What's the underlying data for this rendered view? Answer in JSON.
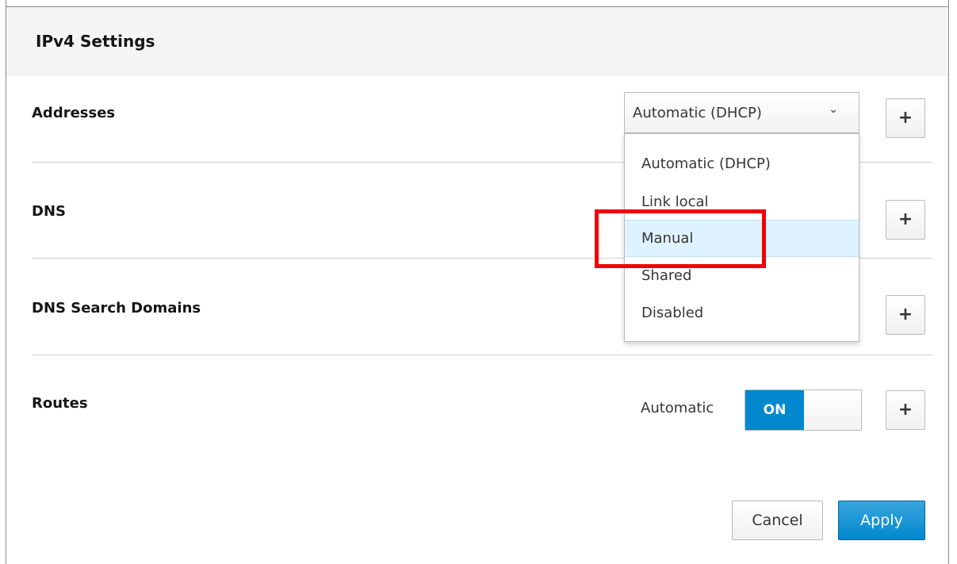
{
  "dialog": {
    "title": "IPv4 Settings",
    "rows": {
      "addresses": {
        "label": "Addresses",
        "add_label": "+"
      },
      "dns": {
        "label": "DNS",
        "add_label": "+"
      },
      "dns_search": {
        "label": "DNS Search Domains",
        "add_label": "+"
      },
      "routes": {
        "label": "Routes",
        "add_label": "+"
      }
    },
    "addresses_method": {
      "selected": "Automatic (DHCP)",
      "chevron": "⌄",
      "options": [
        "Automatic (DHCP)",
        "Link local",
        "Manual",
        "Shared",
        "Disabled"
      ],
      "hovered_option": "Manual"
    },
    "routes_automatic": {
      "label": "Automatic",
      "toggle_text": "ON",
      "state": "on"
    },
    "footer": {
      "cancel_label": "Cancel",
      "apply_label": "Apply"
    }
  },
  "colors": {
    "accent": "#0088ce",
    "highlight_box": "#f00000",
    "header_bg": "#f5f5f5",
    "active_option_bg": "#def3ff"
  },
  "icons": {
    "add": "plus-icon",
    "dropdown": "chevron-down-icon"
  }
}
